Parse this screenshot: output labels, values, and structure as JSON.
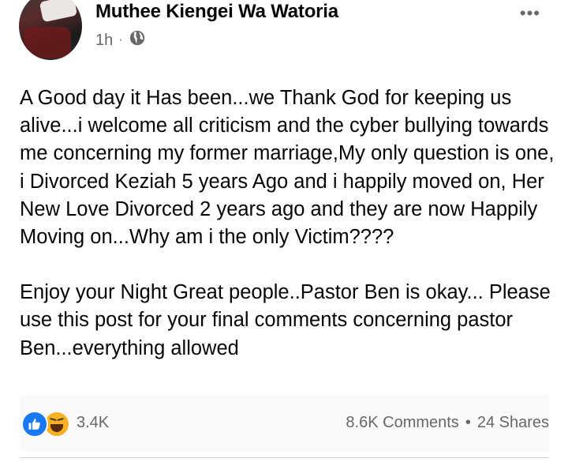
{
  "post": {
    "author": "Muthee Kiengei Wa Watoria",
    "time": "1h",
    "separator": "·",
    "audience_icon": "globe-icon",
    "more_icon": "more-options-icon",
    "more_label": "•••",
    "paragraphs": [
      "A Good day it Has been...we Thank God for keeping us alive...i welcome all criticism and the cyber bullying towards me concerning my former marriage,My only question is one, i Divorced Keziah 5 years Ago and i happily moved on, Her New Love Divorced 2 years ago and they are now Happily Moving on...Why am i the only Victim????",
      "Enjoy your Night Great people..Pastor Ben is okay... Please use this post for your final comments concerning pastor Ben...everything allowed"
    ]
  },
  "reactions": {
    "icons": [
      "like-icon",
      "haha-icon"
    ],
    "count": "3.4K",
    "comments": "8.6K Comments",
    "separator": "•",
    "shares": "24 Shares"
  },
  "colors": {
    "text": "#050505",
    "secondary": "#65676b",
    "like_blue": "#1877f2",
    "haha_yellow": "#f7b125"
  }
}
